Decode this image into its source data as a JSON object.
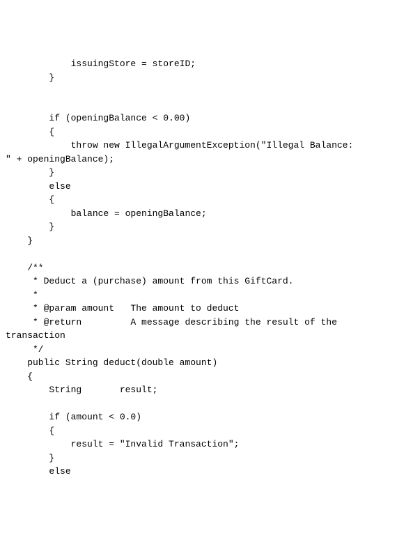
{
  "code": {
    "lines": [
      "            issuingStore = storeID;",
      "        }",
      "",
      "",
      "        if (openingBalance < 0.00)",
      "        {",
      "            throw new IllegalArgumentException(\"Illegal Balance:",
      "\" + openingBalance);",
      "        }",
      "        else",
      "        {",
      "            balance = openingBalance;",
      "        }",
      "    }",
      "",
      "    /**",
      "     * Deduct a (purchase) amount from this GiftCard.",
      "     *",
      "     * @param amount   The amount to deduct",
      "     * @return         A message describing the result of the",
      "transaction",
      "     */",
      "    public String deduct(double amount)",
      "    {",
      "        String       result;",
      "",
      "        if (amount < 0.0)",
      "        {",
      "            result = \"Invalid Transaction\";",
      "        }",
      "        else"
    ]
  }
}
